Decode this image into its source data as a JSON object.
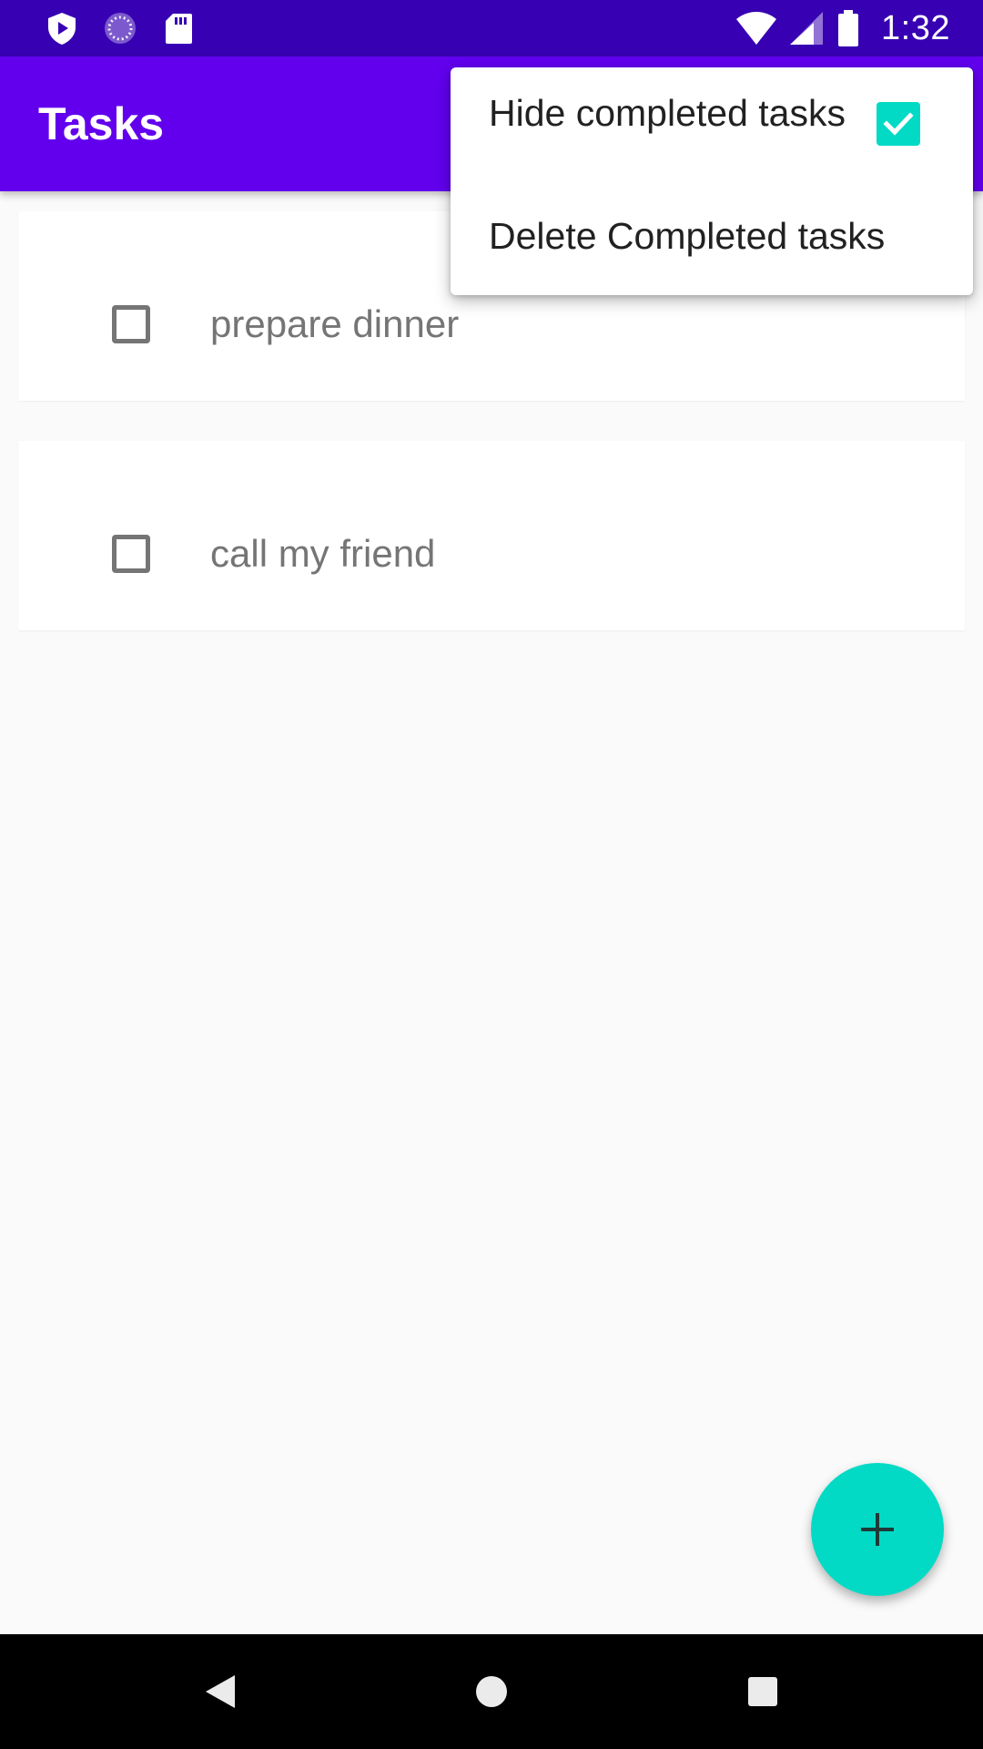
{
  "status_bar": {
    "time": "1:32",
    "left_icons": [
      "play-protect-icon",
      "loading-icon",
      "sd-card-icon"
    ],
    "right_icons": [
      "wifi-icon",
      "cell-signal-icon",
      "battery-icon"
    ]
  },
  "app_bar": {
    "title": "Tasks"
  },
  "tasks": [
    {
      "label": "prepare dinner",
      "checked": false
    },
    {
      "label": "call my friend",
      "checked": false
    }
  ],
  "overflow_menu": {
    "items": [
      {
        "label": "Hide completed tasks",
        "checked": true
      },
      {
        "label": "Delete Completed tasks"
      }
    ]
  },
  "fab": {
    "icon": "plus-icon"
  },
  "nav_bar": {
    "icons": [
      "back-icon",
      "home-icon",
      "recents-icon"
    ]
  },
  "colors": {
    "status_bar": "#3700B3",
    "app_bar": "#6200EE",
    "accent": "#03DAC5",
    "background": "#FAFAFA"
  }
}
